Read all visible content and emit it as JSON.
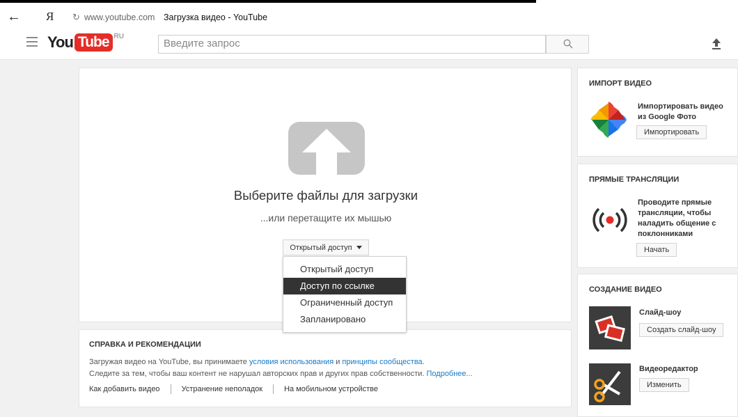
{
  "browser": {
    "back_icon": "back-arrow-icon",
    "yandex_glyph": "Я",
    "domain": "www.youtube.com",
    "page_title": "Загрузка видео - YouTube"
  },
  "header": {
    "logo_you": "You",
    "logo_tube": "Tube",
    "logo_region": "RU",
    "search_placeholder": "Введите запрос"
  },
  "upload": {
    "title": "Выберите файлы для загрузки",
    "subtitle": "...или перетащите их мышью",
    "privacy_selected": "Открытый доступ",
    "privacy_options": [
      {
        "label": "Открытый доступ"
      },
      {
        "label": "Доступ по ссылке"
      },
      {
        "label": "Ограниченный доступ"
      },
      {
        "label": "Запланировано"
      }
    ],
    "highlighted_option": "Доступ по ссылке"
  },
  "help": {
    "title": "Справка и рекомендации",
    "line1_prefix": "Загружая видео на YouTube, вы принимаете ",
    "line1_link1": "условия использования",
    "line1_mid": " и ",
    "line1_link2": "принципы сообщества",
    "line1_suffix": ".",
    "line2_prefix": "Следите за тем, чтобы ваш контент не нарушал авторских прав и других прав собственности. ",
    "line2_link": "Подробнее...",
    "links": [
      "Как добавить видео",
      "Устранение неполадок",
      "На мобильном устройстве"
    ]
  },
  "sidebar": {
    "import": {
      "title": "ИМПОРТ ВИДЕО",
      "desc_line1": "Импортировать видео",
      "desc_line2": "из Google Фото",
      "button": "Импортировать"
    },
    "live": {
      "title": "ПРЯМЫЕ ТРАНСЛЯЦИИ",
      "desc_lines": [
        "Проводите прямые",
        "трансляции, чтобы",
        "наладить общение с",
        "поклонниками"
      ],
      "button": "Начать"
    },
    "create": {
      "title": "СОЗДАНИЕ ВИДЕО",
      "slideshow_title": "Слайд-шоу",
      "slideshow_button": "Создать слайд-шоу",
      "editor_title": "Видеоредактор",
      "editor_button": "Изменить"
    }
  },
  "colors": {
    "brand_red": "#e52d27",
    "link_blue": "#167ac6",
    "dropdown_highlight": "#333333",
    "page_gray": "#f1f1f1"
  }
}
